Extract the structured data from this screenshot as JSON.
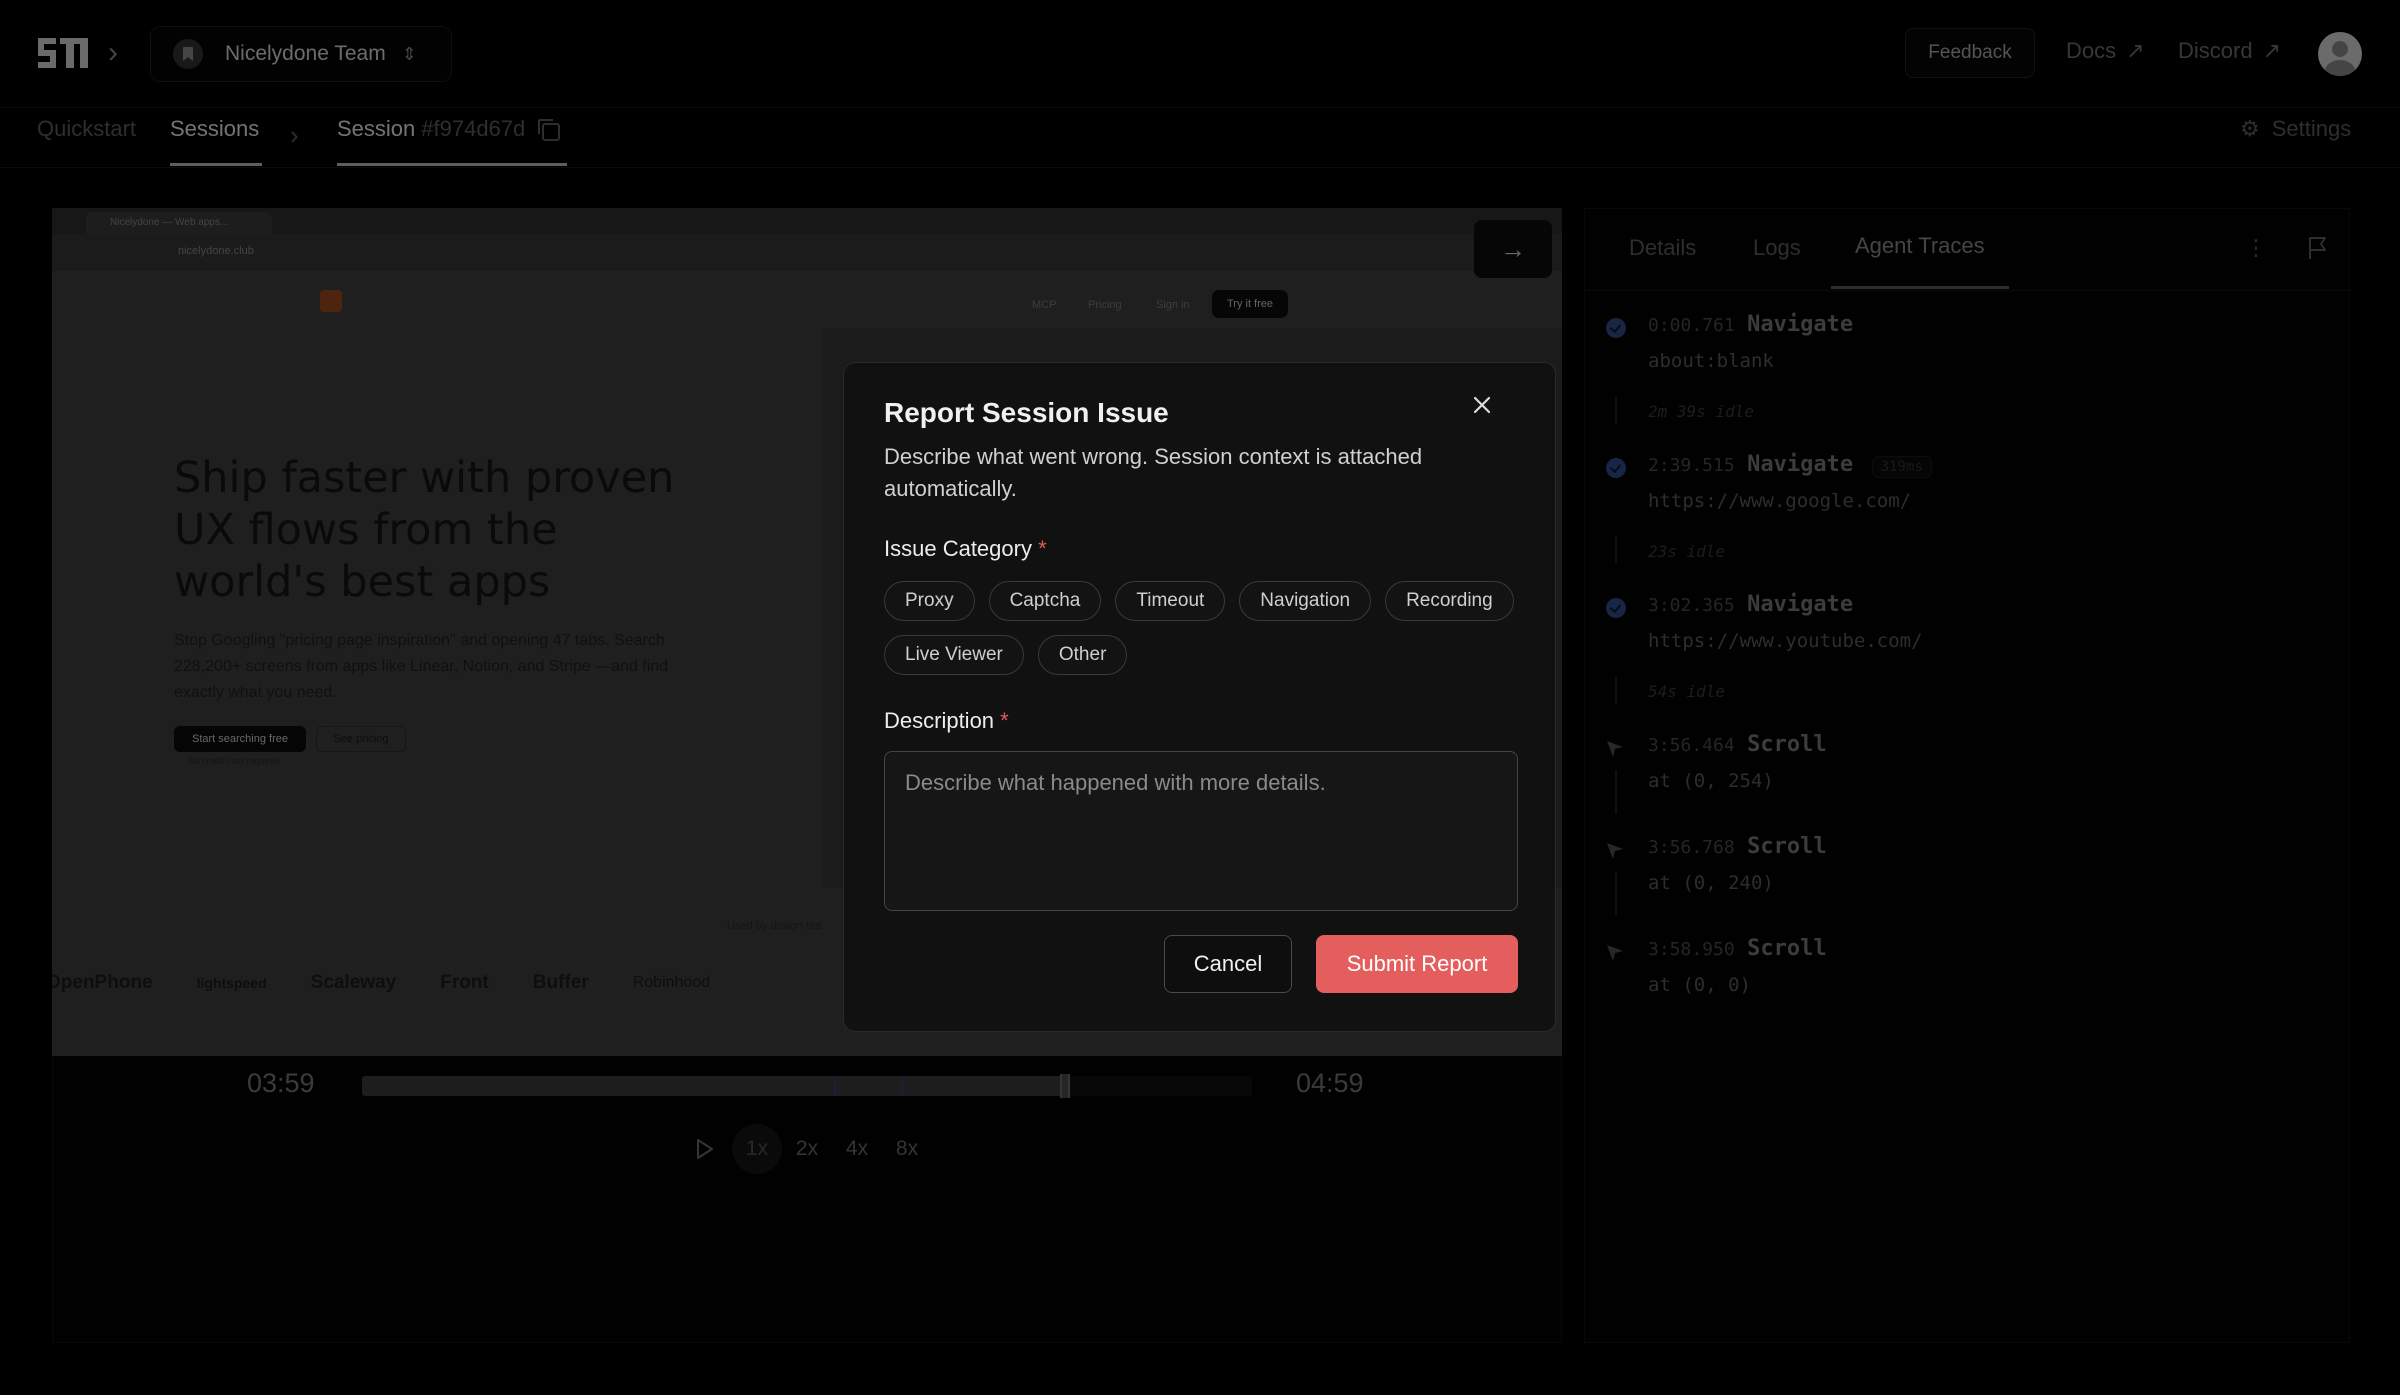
{
  "header": {
    "team": {
      "name": "Nicelydone Team"
    },
    "feedback_label": "Feedback",
    "links": [
      {
        "label": "Docs"
      },
      {
        "label": "Discord"
      }
    ]
  },
  "nav": {
    "tabs": [
      {
        "label": "Quickstart",
        "active": false
      },
      {
        "label": "Sessions",
        "active": true
      }
    ],
    "session_label": "Session",
    "session_id": "#f974d67d",
    "settings_label": "Settings"
  },
  "recording": {
    "browser_tab_title": "Nicelydone — Web apps...",
    "url": "nicelydone.club",
    "site_nav": [
      "MCP",
      "Pricing",
      "Sign in"
    ],
    "site_cta": "Try it free",
    "hero_title": "Ship faster with proven UX flows from the world's best apps",
    "hero_subtitle": "Stop Googling \"pricing page inspiration\" and opening 47 tabs. Search 228,200+ screens from apps like Linear, Notion, and Stripe —and find exactly what you need.",
    "primary_cta": "Start searching free",
    "secondary_cta": "See pricing",
    "cta_note": "No credit card required",
    "used_by": "Used by design tea",
    "logos": [
      "OpenPhone",
      "lightspeed",
      "Scaleway",
      "Front",
      "Buffer",
      "Robinhood"
    ]
  },
  "player": {
    "current_time": "03:59",
    "end_time": "04:59",
    "progress": 0.79,
    "markers": [
      0.53,
      0.606
    ],
    "speeds": [
      {
        "label": "1x",
        "selected": true
      },
      {
        "label": "2x",
        "selected": false
      },
      {
        "label": "4x",
        "selected": false
      },
      {
        "label": "8x",
        "selected": false
      }
    ]
  },
  "side_panel": {
    "tabs": [
      {
        "label": "Details",
        "active": false
      },
      {
        "label": "Logs",
        "active": false
      },
      {
        "label": "Agent Traces",
        "active": true
      }
    ],
    "traces": [
      {
        "time": "0:00.761",
        "action": "Navigate",
        "detail": "about:blank",
        "idle": "2m 39s idle"
      },
      {
        "time": "2:39.515",
        "action": "Navigate",
        "badge": "319ms",
        "detail": "https://www.google.com/",
        "idle": "23s idle"
      },
      {
        "time": "3:02.365",
        "action": "Navigate",
        "detail": "https://www.youtube.com/",
        "idle": "54s idle"
      },
      {
        "time": "3:56.464",
        "action": "Scroll",
        "detail": "at (0, 254)"
      },
      {
        "time": "3:56.768",
        "action": "Scroll",
        "detail": "at (0, 240)"
      },
      {
        "time": "3:58.950",
        "action": "Scroll",
        "detail": "at (0, 0)"
      }
    ]
  },
  "modal": {
    "title": "Report Session Issue",
    "description": "Describe what went wrong. Session context is attached automatically.",
    "category_label": "Issue Category",
    "required_mark": "*",
    "categories": [
      "Proxy",
      "Captcha",
      "Timeout",
      "Navigation",
      "Recording",
      "Live Viewer",
      "Other"
    ],
    "description_label": "Description",
    "description_placeholder": "Describe what happened with more details.",
    "cancel_label": "Cancel",
    "submit_label": "Submit Report"
  },
  "colors": {
    "accent_submit": "#e55e5e",
    "required": "#e05a5a",
    "trace_dot": "#2d4d88"
  }
}
